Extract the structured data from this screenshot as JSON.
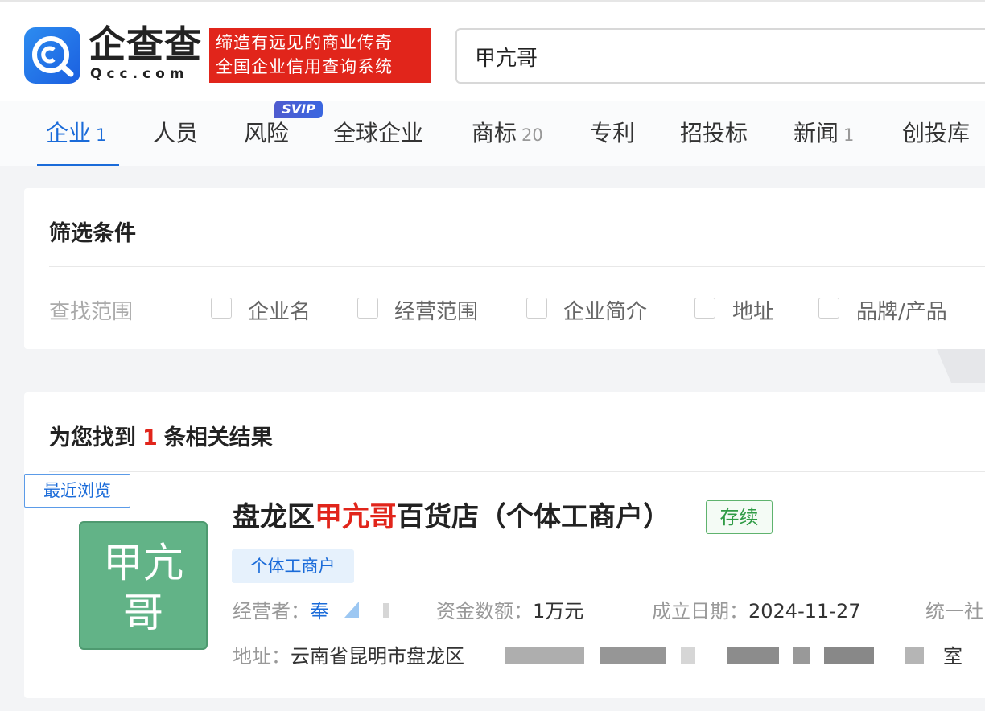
{
  "header": {
    "logo_cn": "企查查",
    "logo_en": "Qcc.com",
    "slogan_line1": "缔造有远见的商业传奇",
    "slogan_line2": "全国企业信用查询系统",
    "search_value": "甲亢哥"
  },
  "tabs": [
    {
      "label": "企业",
      "count": "1"
    },
    {
      "label": "人员",
      "count": ""
    },
    {
      "label": "风险",
      "count": ""
    },
    {
      "label": "全球企业",
      "count": ""
    },
    {
      "label": "商标",
      "count": "20"
    },
    {
      "label": "专利",
      "count": ""
    },
    {
      "label": "招投标",
      "count": ""
    },
    {
      "label": "新闻",
      "count": "1"
    },
    {
      "label": "创投库",
      "count": ""
    }
  ],
  "svip_badge": "SVIP",
  "filter": {
    "title": "筛选条件",
    "scope_label": "查找范围",
    "options": [
      "企业名",
      "经营范围",
      "企业简介",
      "地址",
      "品牌/产品"
    ]
  },
  "results": {
    "prefix": "为您找到",
    "count": "1",
    "suffix": "条相关结果",
    "recent_tag": "最近浏览",
    "item": {
      "avatar_line1": "甲亢",
      "avatar_line2": "哥",
      "name_prefix": "盘龙区",
      "name_highlight": "甲亢哥",
      "name_suffix": "百货店（个体工商户）",
      "status": "存续",
      "type_tag": "个体工商户",
      "operator_label": "经营者：",
      "operator_value": "奉",
      "capital_label": "资金数额：",
      "capital_value": "1万元",
      "founded_label": "成立日期：",
      "founded_value": "2024-11-27",
      "credit_label": "统一社",
      "address_label": "地址：",
      "address_value": "云南省昆明市盘龙区",
      "address_tail": "室"
    }
  },
  "colors": {
    "brand_blue": "#1a6bd9",
    "brand_red": "#e1251b",
    "status_green": "#2f9b45",
    "avatar_green": "#62b387"
  }
}
